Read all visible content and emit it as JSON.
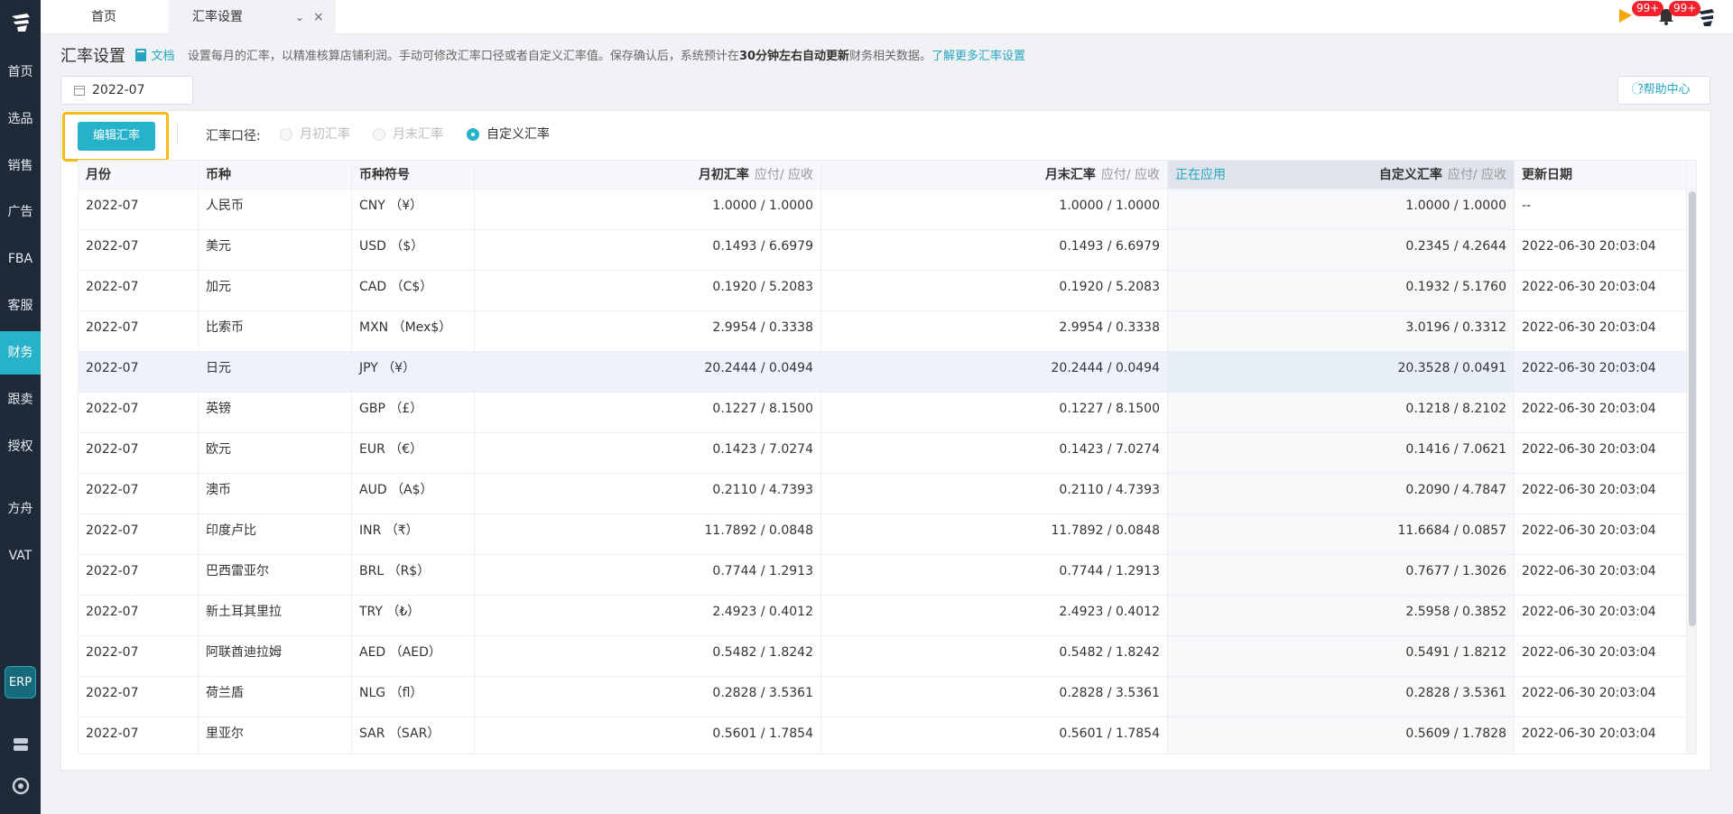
{
  "sidebar": {
    "items": [
      {
        "label": "首页"
      },
      {
        "label": "选品"
      },
      {
        "label": "销售"
      },
      {
        "label": "广告"
      },
      {
        "label": "FBA"
      },
      {
        "label": "客服"
      },
      {
        "label": "财务",
        "active": true
      },
      {
        "label": "跟卖"
      },
      {
        "label": "授权"
      },
      {
        "label": "方舟"
      },
      {
        "label": "VAT"
      }
    ],
    "erp_label": "ERP"
  },
  "topbar": {
    "tabs": [
      {
        "label": "首页"
      },
      {
        "label": "汇率设置"
      }
    ],
    "close_glyph": "×",
    "chevron_glyph": "⌄",
    "flag_badge": "99+",
    "bell_badge": "99+"
  },
  "header": {
    "title": "汇率设置",
    "doc_link": "文档",
    "desc_pre": "设置每月的汇率，以精准核算店铺利润。手动可修改汇率口径或者自定义汇率值。保存确认后，系统预计在",
    "desc_bold": "30分钟左右自动更新",
    "desc_post": "财务相关数据。",
    "more_link": "了解更多汇率设置"
  },
  "filter": {
    "month": "2022-07",
    "help_label": "帮助中心"
  },
  "toolbar": {
    "edit_label": "编辑汇率",
    "caliber_label": "汇率口径:",
    "options": [
      {
        "label": "月初汇率",
        "checked": false
      },
      {
        "label": "月末汇率",
        "checked": false
      },
      {
        "label": "自定义汇率",
        "checked": true
      }
    ]
  },
  "table": {
    "headers": {
      "month": "月份",
      "currency": "币种",
      "symbol": "币种符号",
      "start_rate": "月初汇率",
      "end_rate": "月末汇率",
      "custom_rate": "自定义汇率",
      "rate_sub": "应付/ 应收",
      "applied_tag": "正在应用",
      "updated": "更新日期"
    },
    "rows": [
      {
        "month": "2022-07",
        "currency": "人民币",
        "symbol": "CNY （¥）",
        "start": "1.0000  /  1.0000",
        "end": "1.0000  /  1.0000",
        "custom": "1.0000  /  1.0000",
        "updated": "--"
      },
      {
        "month": "2022-07",
        "currency": "美元",
        "symbol": "USD （$）",
        "start": "0.1493  /  6.6979",
        "end": "0.1493  /  6.6979",
        "custom": "0.2345  /  4.2644",
        "updated": "2022-06-30 20:03:04"
      },
      {
        "month": "2022-07",
        "currency": "加元",
        "symbol": "CAD （C$）",
        "start": "0.1920  /  5.2083",
        "end": "0.1920  /  5.2083",
        "custom": "0.1932  /  5.1760",
        "updated": "2022-06-30 20:03:04"
      },
      {
        "month": "2022-07",
        "currency": "比索币",
        "symbol": "MXN （Mex$）",
        "start": "2.9954  /  0.3338",
        "end": "2.9954  /  0.3338",
        "custom": "3.0196  /  0.3312",
        "updated": "2022-06-30 20:03:04"
      },
      {
        "month": "2022-07",
        "currency": "日元",
        "symbol": "JPY （¥）",
        "start": "20.2444  /  0.0494",
        "end": "20.2444  /  0.0494",
        "custom": "20.3528  /  0.0491",
        "updated": "2022-06-30 20:03:04",
        "highlight": true
      },
      {
        "month": "2022-07",
        "currency": "英镑",
        "symbol": "GBP （£）",
        "start": "0.1227  /  8.1500",
        "end": "0.1227  /  8.1500",
        "custom": "0.1218  /  8.2102",
        "updated": "2022-06-30 20:03:04"
      },
      {
        "month": "2022-07",
        "currency": "欧元",
        "symbol": "EUR （€）",
        "start": "0.1423  /  7.0274",
        "end": "0.1423  /  7.0274",
        "custom": "0.1416  /  7.0621",
        "updated": "2022-06-30 20:03:04"
      },
      {
        "month": "2022-07",
        "currency": "澳币",
        "symbol": "AUD （A$）",
        "start": "0.2110  /  4.7393",
        "end": "0.2110  /  4.7393",
        "custom": "0.2090  /  4.7847",
        "updated": "2022-06-30 20:03:04"
      },
      {
        "month": "2022-07",
        "currency": "印度卢比",
        "symbol": "INR （₹）",
        "start": "11.7892  /  0.0848",
        "end": "11.7892  /  0.0848",
        "custom": "11.6684  /  0.0857",
        "updated": "2022-06-30 20:03:04"
      },
      {
        "month": "2022-07",
        "currency": "巴西雷亚尔",
        "symbol": "BRL （R$）",
        "start": "0.7744  /  1.2913",
        "end": "0.7744  /  1.2913",
        "custom": "0.7677  /  1.3026",
        "updated": "2022-06-30 20:03:04"
      },
      {
        "month": "2022-07",
        "currency": "新土耳其里拉",
        "symbol": "TRY （₺）",
        "start": "2.4923  /  0.4012",
        "end": "2.4923  /  0.4012",
        "custom": "2.5958  /  0.3852",
        "updated": "2022-06-30 20:03:04"
      },
      {
        "month": "2022-07",
        "currency": "阿联酋迪拉姆",
        "symbol": "AED （AED）",
        "start": "0.5482  /  1.8242",
        "end": "0.5482  /  1.8242",
        "custom": "0.5491  /  1.8212",
        "updated": "2022-06-30 20:03:04"
      },
      {
        "month": "2022-07",
        "currency": "荷兰盾",
        "symbol": "NLG （fl）",
        "start": "0.2828  /  3.5361",
        "end": "0.2828  /  3.5361",
        "custom": "0.2828  /  3.5361",
        "updated": "2022-06-30 20:03:04"
      },
      {
        "month": "2022-07",
        "currency": "里亚尔",
        "symbol": "SAR （SAR）",
        "start": "0.5601  /  1.7854",
        "end": "0.5601  /  1.7854",
        "custom": "0.5609  /  1.7828",
        "updated": "2022-06-30 20:03:04"
      }
    ]
  },
  "colors": {
    "accent": "#26b2c8",
    "sidebar_bg": "#1f2a38",
    "highlight_border": "#f7b917",
    "badge": "#f5222d"
  }
}
